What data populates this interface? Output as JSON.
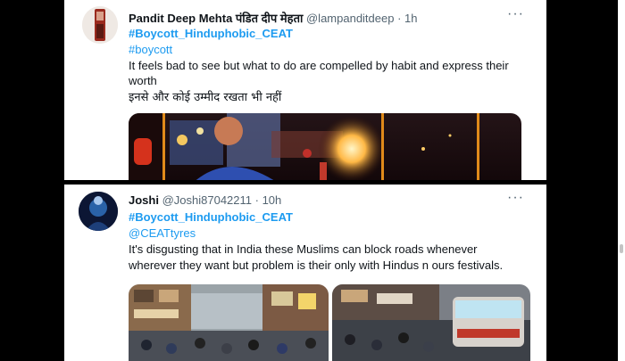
{
  "tweets": [
    {
      "name": "Pandit Deep Mehta पंडित दीप मेहता",
      "handle_time": "@lampanditdeep · 1h",
      "hashtag": "#Boycott_Hinduphobic_CEAT",
      "tag2": "#boycott",
      "text_line1": "It feels bad to see but what to do are compelled by habit and express their",
      "text_line2": "worth",
      "text_line3": "इनसे और कोई उम्मीद रखता भी नहीं"
    },
    {
      "name": "Joshi",
      "handle_time": "@Joshi87042211 · 10h",
      "hashtag": "#Boycott_Hinduphobic_CEAT",
      "mention": "@CEATtyres",
      "text_line1": "It's disgusting that in India these Muslims can block roads whenever",
      "text_line2": "wherever they want but problem is their only with Hindus n ours festivals."
    }
  ],
  "more_glyph": "···",
  "icons": {
    "more": "more-icon"
  }
}
